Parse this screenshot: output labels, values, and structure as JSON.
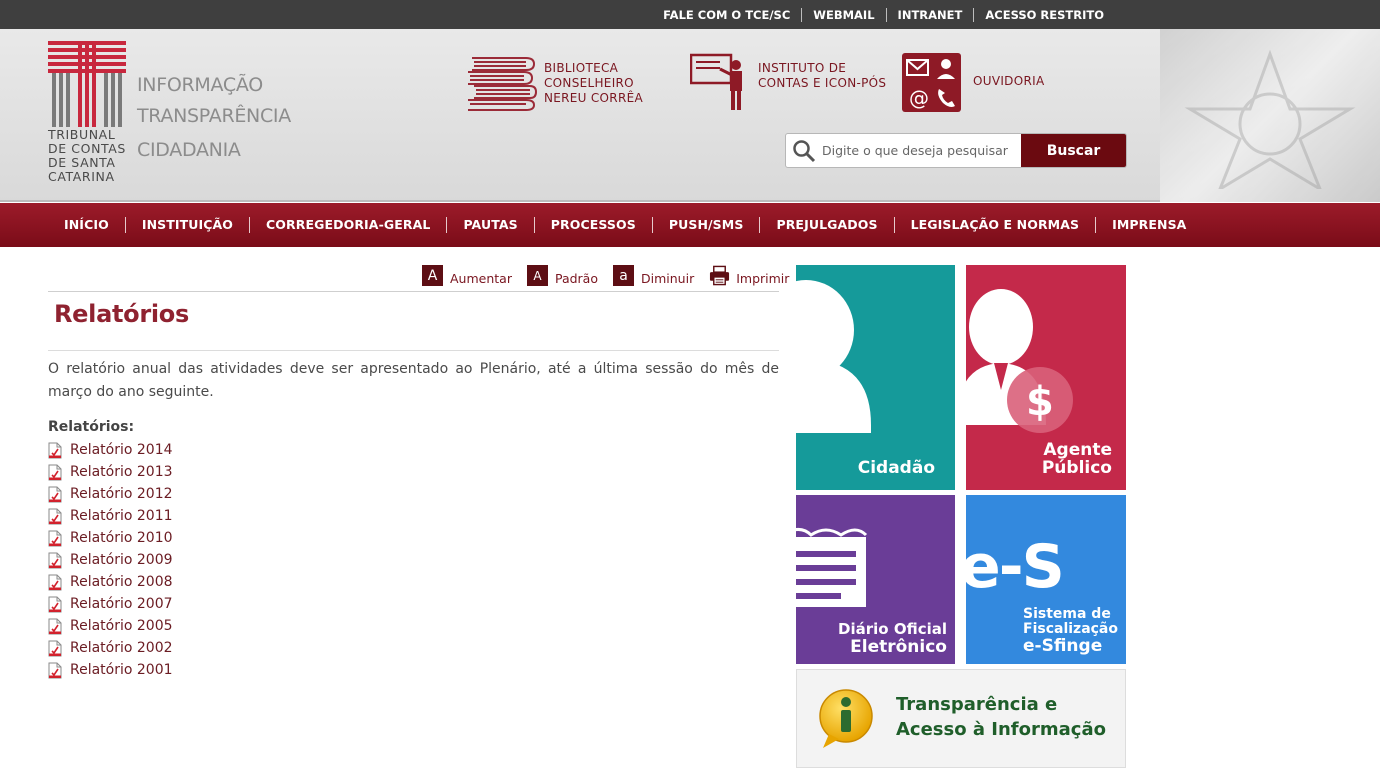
{
  "topbar": {
    "links": [
      "FALE COM O TCE/SC",
      "WEBMAIL",
      "INTRANET",
      "ACESSO RESTRITO"
    ]
  },
  "logo": {
    "lines": [
      "TRIBUNAL",
      "DE CONTAS",
      "DE SANTA",
      "CATARINA"
    ],
    "tagline": [
      "INFORMAÇÃO",
      "TRANSPARÊNCIA",
      "CIDADANIA"
    ]
  },
  "header_links": {
    "biblioteca": [
      "BIBLIOTECA",
      "CONSELHEIRO",
      "NEREU CORRÊA"
    ],
    "instituto": [
      "INSTITUTO DE",
      "CONTAS E ICON-PÓS"
    ],
    "ouvidoria": "OUVIDORIA"
  },
  "search": {
    "placeholder": "Digite o que deseja pesquisar",
    "button": "Buscar"
  },
  "nav": [
    "INÍCIO",
    "INSTITUIÇÃO",
    "CORREGEDORIA-GERAL",
    "PAUTAS",
    "PROCESSOS",
    "PUSH/SMS",
    "PREJULGADOS",
    "LEGISLAÇÃO E NORMAS",
    "IMPRENSA"
  ],
  "tools": {
    "aumentar": {
      "glyph": "A",
      "label": "Aumentar"
    },
    "padrao": {
      "glyph": "A",
      "label": "Padrão"
    },
    "diminuir": {
      "glyph": "a",
      "label": "Diminuir"
    },
    "imprimir": {
      "label": "Imprimir"
    }
  },
  "content": {
    "title": "Relatórios",
    "intro": "O relatório anual das atividades deve ser apresentado ao Plenário, até a última sessão do mês de março do ano seguinte.",
    "list_heading": "Relatórios:",
    "reports": [
      "Relatório 2014",
      "Relatório 2013",
      "Relatório 2012",
      "Relatório 2011",
      "Relatório 2010",
      "Relatório 2009",
      "Relatório 2008",
      "Relatório 2007",
      "Relatório 2005",
      "Relatório 2002",
      "Relatório 2001"
    ]
  },
  "tiles": {
    "cidadao": {
      "label": "Cidadão",
      "color": "#159a9a"
    },
    "agente": {
      "label_1": "Agente",
      "label_2": "Público",
      "color": "#c4294a"
    },
    "diario": {
      "label_1": "Diário Oficial",
      "label_2": "Eletrônico",
      "color": "#6a3d97"
    },
    "esfinge": {
      "big": "e-S",
      "label_1": "Sistema de",
      "label_2": "Fiscalização",
      "label_3": "e-Sfinge",
      "color": "#3389de"
    }
  },
  "info_box": {
    "line1": "Transparência e",
    "line2": "Acesso à Informação"
  },
  "colors": {
    "brand": "#7a0c18",
    "link": "#7a1620",
    "title": "#8f2230"
  }
}
